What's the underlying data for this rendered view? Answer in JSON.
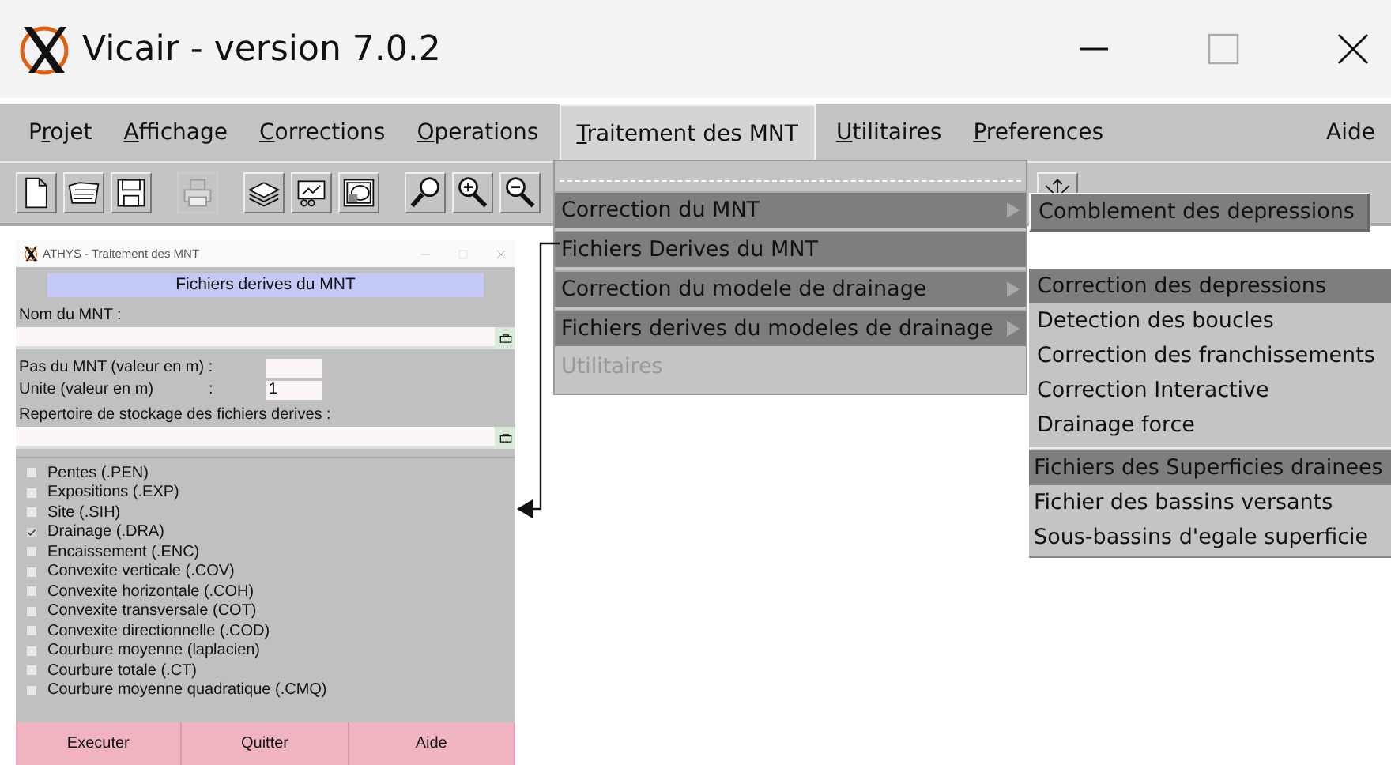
{
  "window": {
    "title": "Vicair - version 7.0.2"
  },
  "menu_bar": [
    {
      "selected": false,
      "label": [
        {
          "text": "P",
          "underlined": false
        },
        {
          "text": "r",
          "underlined": true
        },
        {
          "text": "ojet",
          "underlined": false
        }
      ]
    },
    {
      "selected": false,
      "label": [
        {
          "text": "A",
          "underlined": true
        },
        {
          "text": "ffichage",
          "underlined": false
        }
      ]
    },
    {
      "selected": false,
      "label": [
        {
          "text": "C",
          "underlined": true
        },
        {
          "text": "orrections",
          "underlined": false
        }
      ]
    },
    {
      "selected": false,
      "label": [
        {
          "text": "O",
          "underlined": true
        },
        {
          "text": "perations",
          "underlined": false
        }
      ]
    },
    {
      "selected": true,
      "label": [
        {
          "text": "T",
          "underlined": true
        },
        {
          "text": "raitement des MNT",
          "underlined": false
        }
      ]
    },
    {
      "selected": false,
      "label": [
        {
          "text": "U",
          "underlined": true
        },
        {
          "text": "tilitaires",
          "underlined": false
        }
      ]
    },
    {
      "selected": false,
      "label": [
        {
          "text": "P",
          "underlined": true
        },
        {
          "text": "references",
          "underlined": false
        }
      ]
    },
    {
      "selected": false,
      "label": [
        {
          "text": "Aide",
          "underlined": false
        }
      ]
    }
  ],
  "toolbar": {
    "groups": [
      {
        "buttons": [
          {
            "kind": "new-file",
            "disabled": false
          },
          {
            "kind": "open-folder",
            "disabled": false
          },
          {
            "kind": "save",
            "disabled": false
          }
        ]
      },
      {
        "buttons": [
          {
            "kind": "printer",
            "disabled": true
          }
        ]
      },
      {
        "buttons": [
          {
            "kind": "layers",
            "disabled": false
          },
          {
            "kind": "chart",
            "disabled": false
          },
          {
            "kind": "image",
            "disabled": false
          }
        ]
      },
      {
        "buttons": [
          {
            "kind": "zoom",
            "disabled": false
          },
          {
            "kind": "zoom-in",
            "disabled": false
          },
          {
            "kind": "zoom-out",
            "disabled": false
          }
        ]
      },
      {
        "buttons": [
          {
            "kind": "expand",
            "disabled": false
          }
        ]
      }
    ]
  },
  "dropdown": {
    "items": [
      {
        "label": "Correction du MNT",
        "highlighted": true,
        "has_submenu": true,
        "disabled": false
      },
      {
        "label": "Fichiers Derives du MNT",
        "highlighted": true,
        "has_submenu": false,
        "disabled": false
      },
      {
        "label": "Correction du modele de drainage",
        "highlighted": true,
        "has_submenu": true,
        "disabled": false
      },
      {
        "label": "Fichiers derives du modeles de drainage",
        "highlighted": true,
        "has_submenu": true,
        "disabled": false
      },
      {
        "label": "Utilitaires",
        "highlighted": false,
        "has_submenu": false,
        "disabled": true
      }
    ]
  },
  "submenus": [
    {
      "sections": [
        {
          "items": [
            {
              "label": "Comblement des depressions",
              "highlighted": true
            }
          ]
        }
      ]
    },
    {
      "sections": [
        {
          "items": [
            {
              "label": "Correction des depressions",
              "highlighted": true
            },
            {
              "label": "Detection des boucles",
              "highlighted": false
            },
            {
              "label": "Correction des franchissements",
              "highlighted": false
            },
            {
              "label": "Correction Interactive",
              "highlighted": false
            },
            {
              "label": "Drainage force",
              "highlighted": false
            }
          ]
        },
        {
          "items": [
            {
              "label": "Fichiers des Superficies drainees",
              "highlighted": true
            },
            {
              "label": "Fichier des bassins versants",
              "highlighted": false
            },
            {
              "label": "Sous-bassins d'egale superficie",
              "highlighted": false
            }
          ]
        }
      ]
    }
  ],
  "dialog": {
    "title": "ATHYS - Traitement des MNT",
    "heading": "Fichiers derives du MNT",
    "mnt_name": {
      "label": "Nom du MNT :"
    },
    "step": {
      "label": "Pas du MNT (valeur en m) :"
    },
    "unit": {
      "label": "Unite (valeur en m)",
      "separator": ":",
      "value": "1"
    },
    "directory": {
      "label": "Repertoire de stockage des fichiers derives :"
    },
    "outputs": [
      {
        "label": "Pentes (.PEN)",
        "checked": false
      },
      {
        "label": "Expositions (.EXP)",
        "checked": false
      },
      {
        "label": "Site (.SIH)",
        "checked": false
      },
      {
        "label": "Drainage (.DRA)",
        "checked": true
      },
      {
        "label": "Encaissement (.ENC)",
        "checked": false
      },
      {
        "label": "Convexite verticale (.COV)",
        "checked": false
      },
      {
        "label": "Convexite horizontale (.COH)",
        "checked": false
      },
      {
        "label": "Convexite transversale (COT)",
        "checked": false
      },
      {
        "label": "Convexite directionnelle (.COD)",
        "checked": false
      },
      {
        "label": "Courbure moyenne (laplacien)",
        "checked": false
      },
      {
        "label": "Courbure totale (.CT)",
        "checked": false
      },
      {
        "label": "Courbure moyenne quadratique (.CMQ)",
        "checked": false
      }
    ],
    "buttons": [
      "Executer",
      "Quitter",
      "Aide"
    ]
  }
}
